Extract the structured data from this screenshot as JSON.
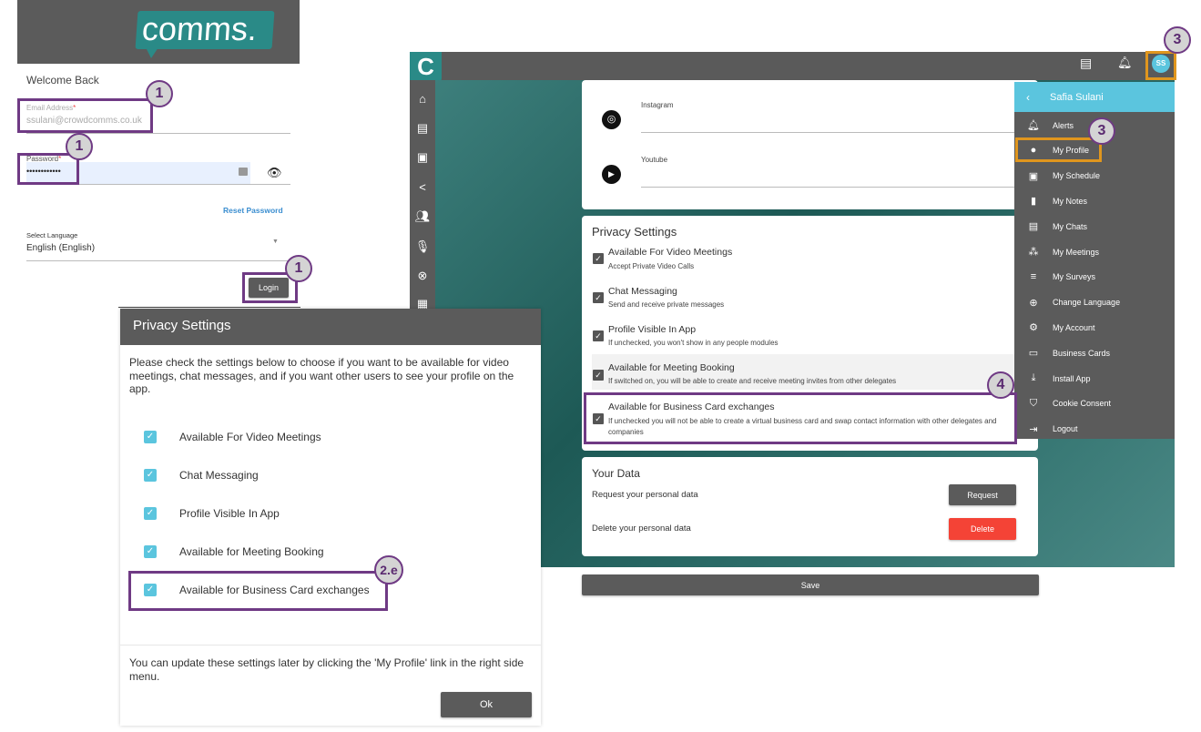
{
  "login": {
    "logo_text": "comms.",
    "welcome": "Welcome Back",
    "email_label": "Email Address",
    "email_value": "ssulani@crowdcomms.co.uk",
    "password_label": "Password",
    "password_value": "••••••••••••",
    "required_mark": "*",
    "reset_password": "Reset Password",
    "language_label": "Select Language",
    "language_value": "English (English)",
    "login_button": "Login"
  },
  "app": {
    "logo_text": "C",
    "rail_icons": [
      "home-icon",
      "agenda-icon",
      "calendar-icon",
      "share-icon",
      "people-icon",
      "microphone-icon",
      "cancel-icon",
      "building-icon"
    ],
    "topbar": {
      "avatar_initials": "SS"
    },
    "social": {
      "instagram_label": "Instagram",
      "youtube_label": "Youtube"
    },
    "privacy": {
      "title": "Privacy Settings",
      "items": [
        {
          "title": "Available For Video Meetings",
          "subtitle": "Accept Private Video Calls",
          "checked": true
        },
        {
          "title": "Chat Messaging",
          "subtitle": "Send and receive private messages",
          "checked": true
        },
        {
          "title": "Profile Visible In App",
          "subtitle": "If unchecked, you won't show in any people modules",
          "checked": true
        },
        {
          "title": "Available for Meeting Booking",
          "subtitle": "If switched on, you will be able to create and receive meeting invites from other delegates",
          "checked": true
        },
        {
          "title": "Available for Business Card exchanges",
          "subtitle": "If unchecked you will not be able to create a virtual business card and swap contact information with other delegates and companies",
          "checked": true
        }
      ]
    },
    "your_data": {
      "title": "Your Data",
      "request_label": "Request your personal data",
      "request_button": "Request",
      "delete_label": "Delete your personal data",
      "delete_button": "Delete"
    },
    "save_button": "Save",
    "drawer": {
      "user_name": "Safia Sulani",
      "items": [
        {
          "label": "Alerts",
          "icon": "bell-icon"
        },
        {
          "label": "My Profile",
          "icon": "person-icon"
        },
        {
          "label": "My Schedule",
          "icon": "calendar-icon"
        },
        {
          "label": "My Notes",
          "icon": "bookmark-icon"
        },
        {
          "label": "My Chats",
          "icon": "chat-icon"
        },
        {
          "label": "My Meetings",
          "icon": "group-icon"
        },
        {
          "label": "My Surveys",
          "icon": "list-icon"
        },
        {
          "label": "Change Language",
          "icon": "globe-icon"
        },
        {
          "label": "My Account",
          "icon": "gear-icon"
        },
        {
          "label": "Business Cards",
          "icon": "card-icon"
        },
        {
          "label": "Install App",
          "icon": "download-icon"
        },
        {
          "label": "Cookie Consent",
          "icon": "shield-icon"
        },
        {
          "label": "Logout",
          "icon": "logout-icon"
        }
      ]
    }
  },
  "dialog": {
    "title": "Privacy Settings",
    "intro": "Please check the settings below to choose if you want to be available for video meetings, chat messages, and if you want other users to see your profile on the app.",
    "items": [
      "Available For Video Meetings",
      "Chat Messaging",
      "Profile Visible In App",
      "Available for Meeting Booking",
      "Available for Business Card exchanges"
    ],
    "footer": "You can update these settings later by clicking the 'My Profile' link in the right side menu.",
    "ok_button": "Ok"
  },
  "annotations": {
    "step1": "1",
    "step2e": "2.e",
    "step3": "3",
    "step4": "4"
  },
  "colors": {
    "dark": "#5b5b5b",
    "teal": "#2a8a87",
    "cyan": "#5bc5de",
    "annotation_purple": "#6f3a84",
    "annotation_orange": "#e0961e",
    "delete_red": "#f44336",
    "link_blue": "#3b8ed0"
  }
}
